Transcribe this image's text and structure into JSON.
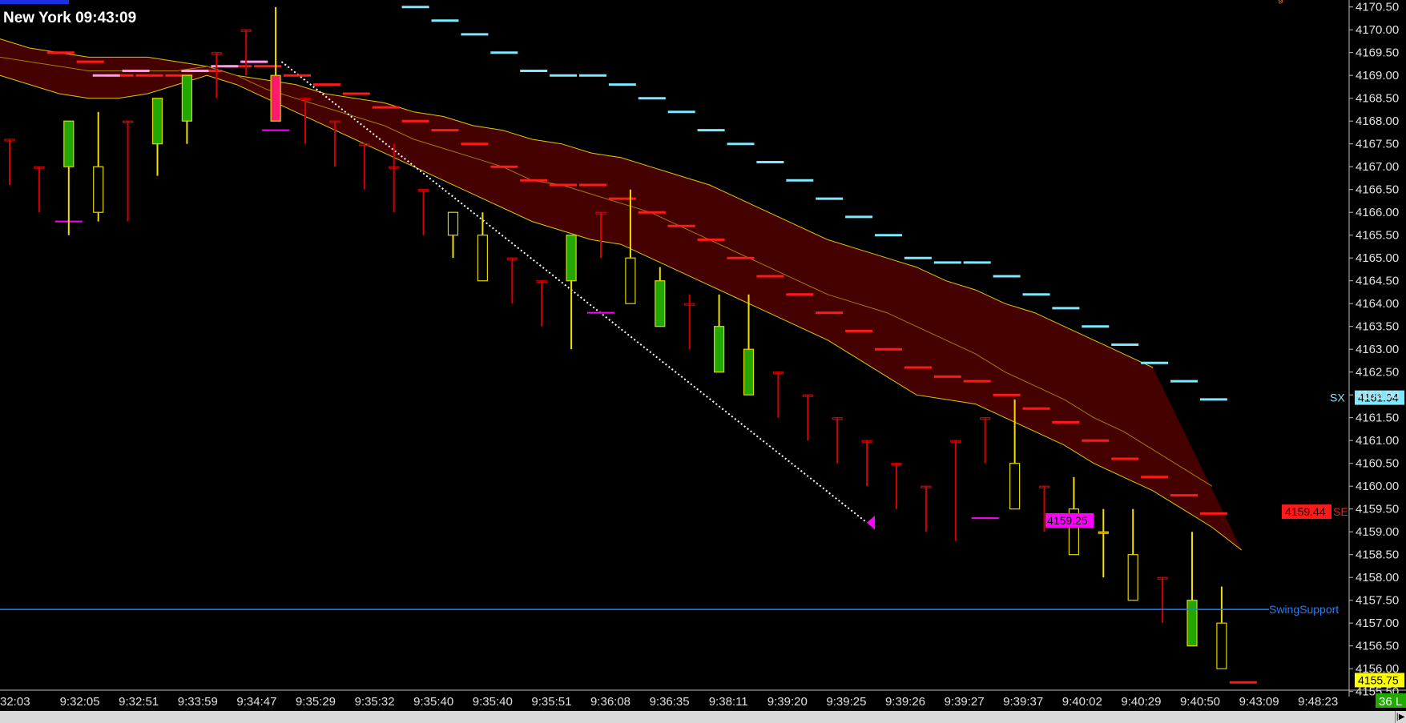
{
  "window": {
    "clock_label": "New York 09:43:09"
  },
  "colors": {
    "background": "#000000",
    "bull_fill": "#22a800",
    "bear_outline": "#d40000",
    "doji_outline": "#e0d400",
    "highlight_fill": "#ff1a6e",
    "wick": "#f0e000",
    "band_fill": "#450000",
    "band_edge": "#e0c800",
    "stop_up": "#ff1a1a",
    "stop_down": "#7fe8ff",
    "swing_support": "#1e7fff",
    "trendline": "#ffffff"
  },
  "chart_data": {
    "type": "candlestick",
    "y_range": [
      4155.6,
      4170.6
    ],
    "y_ticks": [
      "4170.50",
      "4170.00",
      "4169.50",
      "4169.00",
      "4168.50",
      "4168.00",
      "4167.50",
      "4167.00",
      "4166.50",
      "4166.00",
      "4165.50",
      "4165.00",
      "4164.50",
      "4164.00",
      "4163.50",
      "4163.00",
      "4162.50",
      "4162.00",
      "4161.50",
      "4161.00",
      "4160.50",
      "4160.00",
      "4159.50",
      "4159.00",
      "4158.50",
      "4158.00",
      "4157.50",
      "4157.00",
      "4156.50",
      "4156.00",
      "4155.50"
    ],
    "x_labels": [
      "32:03",
      "9:32:05",
      "9:32:51",
      "9:33:59",
      "9:34:47",
      "9:35:29",
      "9:35:32",
      "9:35:40",
      "9:35:40",
      "9:35:51",
      "9:36:08",
      "9:36:35",
      "9:38:11",
      "9:39:20",
      "9:39:25",
      "9:39:26",
      "9:39:27",
      "9:39:37",
      "9:40:02",
      "9:40:29",
      "9:40:50",
      "9:43:09",
      "9:48:23"
    ],
    "bar_count_label": "36 L",
    "candles": [
      [
        4167.6,
        4167.6,
        4166.6,
        4166.6,
        "bear"
      ],
      [
        4167.0,
        4167.0,
        4166.0,
        4166.0,
        "bear"
      ],
      [
        4167.0,
        4168.0,
        4165.5,
        4168.0,
        "bull"
      ],
      [
        4166.0,
        4167.0,
        4168.2,
        4165.8,
        "doji"
      ],
      [
        4168.0,
        4168.0,
        4165.8,
        4167.0,
        "bear"
      ],
      [
        4167.5,
        4168.5,
        4166.8,
        4168.5,
        "bull"
      ],
      [
        4168.0,
        4169.0,
        4167.5,
        4169.0,
        "bull"
      ],
      [
        4169.5,
        4169.5,
        4168.5,
        4168.5,
        "bear"
      ],
      [
        4170.0,
        4170.0,
        4169.0,
        4169.0,
        "bear"
      ],
      [
        4168.0,
        4169.0,
        4170.5,
        4168.0,
        "highlight"
      ],
      [
        4168.5,
        4168.5,
        4167.5,
        4167.5,
        "bear"
      ],
      [
        4168.0,
        4168.0,
        4167.0,
        4167.0,
        "bear"
      ],
      [
        4167.5,
        4167.5,
        4166.5,
        4166.5,
        "bear"
      ],
      [
        4167.0,
        4167.0,
        4167.5,
        4166.0,
        "bear"
      ],
      [
        4166.5,
        4166.5,
        4165.5,
        4165.5,
        "bear"
      ],
      [
        4165.5,
        4166.0,
        4165.5,
        4165.0,
        "doji"
      ],
      [
        4164.5,
        4165.5,
        4166.0,
        4164.5,
        "doji"
      ],
      [
        4165.0,
        4165.0,
        4164.0,
        4164.0,
        "bear"
      ],
      [
        4164.5,
        4164.5,
        4163.5,
        4163.5,
        "bear"
      ],
      [
        4164.5,
        4165.5,
        4163.0,
        4165.5,
        "bull"
      ],
      [
        4166.0,
        4166.0,
        4165.0,
        4165.0,
        "bear"
      ],
      [
        4164.0,
        4165.0,
        4166.5,
        4164.0,
        "doji"
      ],
      [
        4163.5,
        4164.5,
        4164.8,
        4163.5,
        "bull"
      ],
      [
        4164.0,
        4164.0,
        4164.2,
        4163.0,
        "bear"
      ],
      [
        4162.5,
        4163.5,
        4164.2,
        4162.5,
        "bull"
      ],
      [
        4162.0,
        4163.0,
        4164.2,
        4162.0,
        "bull"
      ],
      [
        4162.5,
        4162.5,
        4161.5,
        4161.5,
        "bear"
      ],
      [
        4162.0,
        4162.0,
        4161.0,
        4161.0,
        "bear"
      ],
      [
        4161.5,
        4161.5,
        4160.5,
        4160.5,
        "bear"
      ],
      [
        4161.0,
        4161.0,
        4160.0,
        4160.0,
        "bear"
      ],
      [
        4160.5,
        4160.5,
        4159.5,
        4159.5,
        "bear"
      ],
      [
        4160.0,
        4160.0,
        4159.0,
        4159.0,
        "bear"
      ],
      [
        4161.0,
        4161.0,
        4160.0,
        4158.8,
        "bear"
      ],
      [
        4161.5,
        4161.5,
        4160.5,
        4160.5,
        "bear"
      ],
      [
        4159.5,
        4160.5,
        4161.9,
        4159.5,
        "doji"
      ],
      [
        4160.0,
        4160.0,
        4159.0,
        4159.0,
        "bear"
      ],
      [
        4158.5,
        4159.5,
        4160.2,
        4158.5,
        "doji"
      ],
      [
        4159.0,
        4159.0,
        4159.5,
        4158.0,
        "highlight"
      ],
      [
        4157.5,
        4158.5,
        4159.5,
        4157.5,
        "doji"
      ],
      [
        4158.0,
        4158.0,
        4157.0,
        4157.0,
        "bear"
      ],
      [
        4156.5,
        4157.5,
        4159.0,
        4156.5,
        "bull"
      ],
      [
        4156.0,
        4157.0,
        4157.8,
        4156.0,
        "doji"
      ]
    ],
    "band_upper": [
      4169.8,
      4169.6,
      4169.5,
      4169.4,
      4169.4,
      4169.4,
      4169.3,
      4169.2,
      4169.0,
      4168.9,
      4168.8,
      4168.6,
      4168.5,
      4168.4,
      4168.2,
      4168.1,
      4167.9,
      4167.8,
      4167.6,
      4167.5,
      4167.3,
      4167.2,
      4167.0,
      4166.8,
      4166.6,
      4166.3,
      4166.0,
      4165.7,
      4165.4,
      4165.2,
      4165.0,
      4164.8,
      4164.5,
      4164.3,
      4164.0,
      4163.8,
      4163.5,
      4163.2,
      4162.9,
      4162.6
    ],
    "band_lower": [
      4169.0,
      4168.8,
      4168.6,
      4168.5,
      4168.5,
      4168.6,
      4168.8,
      4169.0,
      4168.8,
      4168.5,
      4168.2,
      4167.9,
      4167.6,
      4167.3,
      4167.0,
      4166.7,
      4166.4,
      4166.1,
      4165.8,
      4165.6,
      4165.4,
      4165.3,
      4165.0,
      4164.7,
      4164.4,
      4164.1,
      4163.8,
      4163.5,
      4163.2,
      4162.8,
      4162.4,
      4162.0,
      4161.9,
      4161.8,
      4161.5,
      4161.2,
      4160.9,
      4160.5,
      4160.2,
      4159.9,
      4159.5,
      4159.1,
      4158.6
    ],
    "band_mid": [
      4169.4,
      4169.3,
      4169.2,
      4169.1,
      4169.1,
      4169.1,
      4169.1,
      4169.2,
      4169.0,
      4168.7,
      4168.5,
      4168.3,
      4168.1,
      4167.9,
      4167.6,
      4167.4,
      4167.2,
      4167.0,
      4166.7,
      4166.6,
      4166.4,
      4166.2,
      4166.0,
      4165.7,
      4165.4,
      4165.1,
      4164.8,
      4164.5,
      4164.2,
      4164.0,
      4163.8,
      4163.5,
      4163.2,
      4162.9,
      4162.5,
      4162.2,
      4161.9,
      4161.5,
      4161.2,
      4160.8,
      4160.4,
      4160.0
    ],
    "stop_up_levels": [
      4170.0,
      4169.5,
      4169.3,
      4169.0,
      4169.0,
      4169.0,
      4169.1,
      4169.2,
      4169.2,
      4169.0,
      4168.8,
      4168.6,
      4168.3,
      4168.0,
      4167.8,
      4167.5,
      4167.0,
      4166.7,
      4166.6,
      4166.6,
      4166.3,
      4166.0,
      4165.7,
      4165.4,
      4165.0,
      4164.6,
      4164.2,
      4163.8,
      4163.4,
      4163.0,
      4162.6,
      4162.4,
      4162.3,
      4162.0,
      4161.7,
      4161.4,
      4161.0,
      4160.6,
      4160.2,
      4159.8,
      4159.4,
      4155.7
    ],
    "stop_down_levels": [
      4170.5,
      4170.2,
      4169.9,
      4169.5,
      4169.1,
      4169.0,
      4169.0,
      4168.8,
      4168.5,
      4168.2,
      4167.8,
      4167.5,
      4167.1,
      4166.7,
      4166.3,
      4165.9,
      4165.5,
      4165.0,
      4164.9,
      4164.9,
      4164.6,
      4164.2,
      4163.9,
      4163.5,
      4163.1,
      4162.7,
      4162.3,
      4161.9
    ],
    "stop_up_start_index": 1,
    "stop_down_start_index": 14,
    "pink_stops": [
      [
        3,
        4169.0
      ],
      [
        4,
        4169.1
      ],
      [
        6,
        4169.1
      ],
      [
        7,
        4169.2
      ],
      [
        8,
        4169.3
      ]
    ],
    "magenta_marks": [
      [
        2,
        4165.8
      ],
      [
        9,
        4167.8
      ],
      [
        20,
        4163.8
      ],
      [
        33,
        4159.3
      ]
    ],
    "swing_support": 4157.3,
    "trendline": {
      "from": [
        9.2,
        4169.3
      ],
      "to": [
        29.0,
        4159.2
      ]
    },
    "labels": {
      "sx_text": "SX",
      "sx_value": "4161.94",
      "se_text": "SE",
      "se_value": "4159.44",
      "entry_value": "4159.25",
      "last_price": "4155.75",
      "swing_support_label": "SwingSupport",
      "top_right_mark": "g"
    }
  }
}
